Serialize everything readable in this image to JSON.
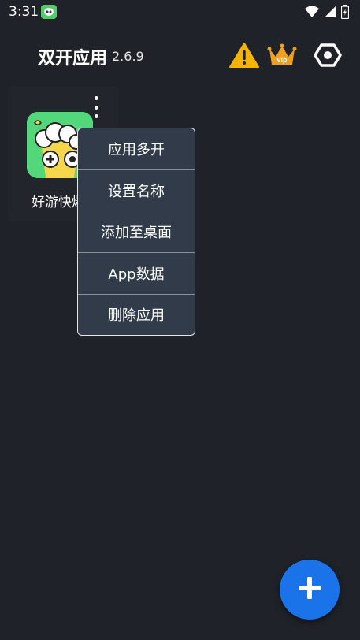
{
  "status_bar": {
    "time": "3:31",
    "icons": [
      "wifi-icon",
      "signal-icon",
      "battery-icon"
    ]
  },
  "header": {
    "title": "双开应用",
    "version": "2.6.9",
    "warning_icon": "warning-icon",
    "vip_icon": "vip-crown-icon",
    "vip_badge": "vip",
    "settings_icon": "hexagon-settings-icon",
    "colors": {
      "warning": "#f5b400",
      "vip": "#f0a020"
    }
  },
  "apps": [
    {
      "name": "好游快爆"
    }
  ],
  "context_menu": {
    "items": [
      "应用多开",
      "设置名称",
      "添加至桌面",
      "App数据",
      "删除应用"
    ]
  },
  "fab": {
    "icon": "plus-icon",
    "color": "#1a73e8"
  }
}
